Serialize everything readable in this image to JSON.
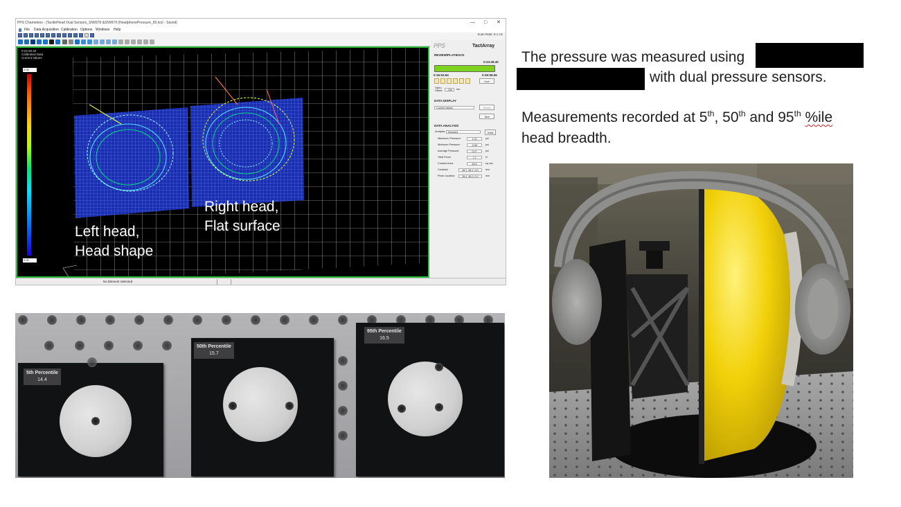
{
  "software": {
    "title": "PPS Chameleon - [TactileHead Dual Sensors_SN9978 &SN9979 (HeadphonePressure_95.tvs) - Saved]",
    "window_controls": [
      "—",
      "□",
      "✕"
    ],
    "menu": [
      "File",
      "Data Acquisition",
      "Calibration",
      "Options",
      "Windows",
      "Help"
    ],
    "scan_rate": "Scan Rate: 9.1 Hz",
    "viewport_info": [
      "0:24:28.40",
      "Calibrated Data",
      "Current Values"
    ],
    "colorbar_max": "2.00",
    "colorbar_min": "0.00",
    "overlay_left": [
      "Left head,",
      "Head shape"
    ],
    "overlay_right": [
      "Right head,",
      "Flat surface"
    ],
    "status": "No Element Selected",
    "panel": {
      "logo": "PPS",
      "product": "TactArray",
      "review_header": "REVIEW/PLAYBACK",
      "time_current": "0:24:28.40",
      "time_start": "0:16:53.94",
      "time_end": "0:25:09.06",
      "live_button": "Live",
      "video_offset_label": "Video Offset:",
      "video_offset_value": "-156",
      "video_offset_unit": "ms",
      "display_header": "DATA DISPLAY",
      "display_select": "Current Values",
      "reset_button": "Reset",
      "tare_button": "Tare",
      "analysis_header": "DATA ANALYSIS",
      "analysis_label": "Analysis:",
      "analysis_select": "Mounted",
      "units_button": "Units",
      "rows": [
        {
          "label": "Maximum Pressure:",
          "value": "1.33",
          "unit": "psi"
        },
        {
          "label": "Minimum Pressure:",
          "value": "-0.06",
          "unit": "psi"
        },
        {
          "label": "Average Pressure:",
          "value": "0.07",
          "unit": "psi"
        },
        {
          "label": "Total Force:",
          "value": "7.2",
          "unit": "N"
        },
        {
          "label": "Contact Area:",
          "value": "63.8",
          "unit": "sq mm"
        },
        {
          "label": "Centroid:",
          "value": "66.7, 58.1, 0.0",
          "unit": "mm"
        },
        {
          "label": "Peak Location:",
          "value": "55.1, 85.3, 0.0",
          "unit": "mm"
        }
      ]
    }
  },
  "text": {
    "line1": "The pressure was measured using",
    "line2": "with dual pressure sensors.",
    "line3_a": "Measurements recorded at 5",
    "sup_th": "th",
    "line3_b": ", 50",
    "line3_c": " and 95",
    "line3_d": " ",
    "line3_e": "%ile",
    "line4": "head breadth."
  },
  "photo_plates": [
    {
      "label": "5th Percentile",
      "value": "14.4"
    },
    {
      "label": "50th Percentile",
      "value": "15.7"
    },
    {
      "label": "95th Percentile",
      "value": "16.5"
    }
  ],
  "colors": {
    "sensor_grid": "#1e2fb4",
    "viewport_border": "#2bbd3b",
    "headphone": "#8e8e8c",
    "head_yellow": "#f2d10a"
  }
}
